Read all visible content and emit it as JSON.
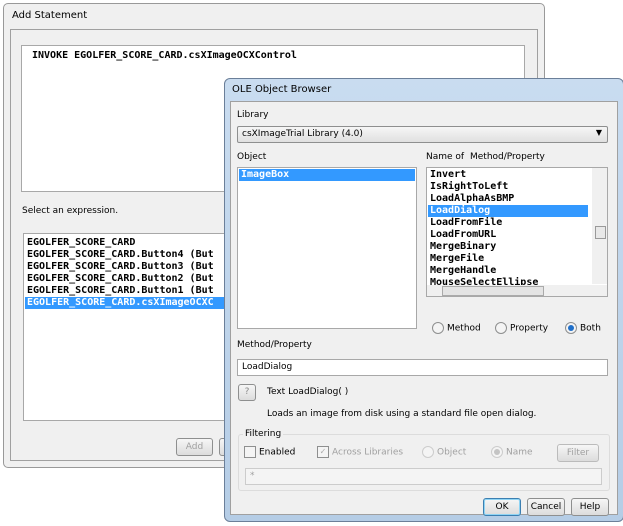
{
  "add_statement": {
    "title": "Add Statement",
    "statement": "INVOKE  EGOLFER_SCORE_CARD.csXImageOCXControl",
    "select_label": "Select an expression.",
    "expressions": [
      "EGOLFER_SCORE_CARD",
      "EGOLFER_SCORE_CARD.Button4 (But",
      "EGOLFER_SCORE_CARD.Button3 (But",
      "EGOLFER_SCORE_CARD.Button2 (But",
      "EGOLFER_SCORE_CARD.Button1 (But",
      "EGOLFER_SCORE_CARD.csXImageOCXC"
    ],
    "selected_expression": 5,
    "add_label": "Add"
  },
  "ole": {
    "title": "OLE Object Browser",
    "library_label": "Library",
    "library_value": "csXImageTrial Library (4.0)",
    "object_label": "Object",
    "objects": [
      "ImageBox"
    ],
    "name_of_label": "Name of",
    "method_property_header": "Method/Property",
    "members": [
      "Invert",
      "IsRightToLeft",
      "LoadAlphaAsBMP",
      "LoadDialog",
      "LoadFromFile",
      "LoadFromURL",
      "MergeBinary",
      "MergeFile",
      "MergeHandle",
      "MouseSelectEllipse"
    ],
    "selected_member": 3,
    "radio_method": "Method",
    "radio_property": "Property",
    "radio_both": "Both",
    "method_property_label": "Method/Property",
    "method_property_value": "LoadDialog",
    "help_btn": "?",
    "signature": "Text LoadDialog( )",
    "description": "Loads an image from disk using a standard file open dialog.",
    "filtering_label": "Filtering",
    "enabled_label": "Enabled",
    "across_label": "Across Libraries",
    "object_radio": "Object",
    "name_radio": "Name",
    "filter_btn": "Filter",
    "filter_value": "*",
    "ok": "OK",
    "cancel": "Cancel",
    "help": "Help"
  }
}
